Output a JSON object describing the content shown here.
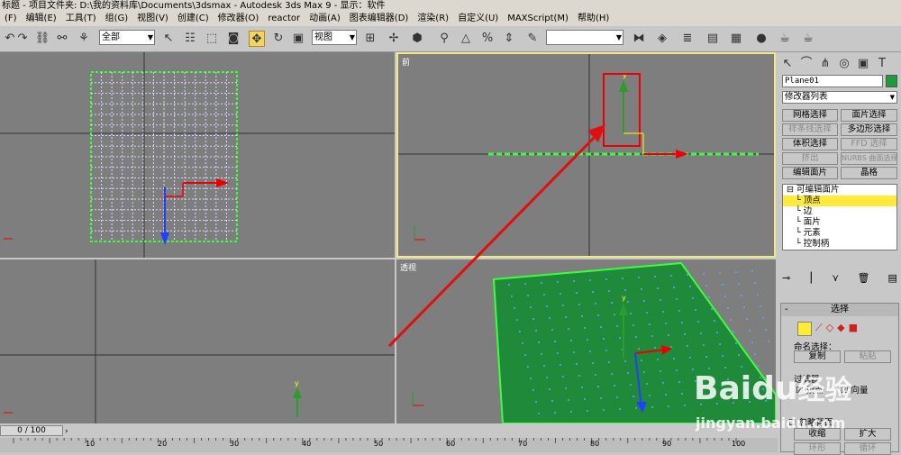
{
  "title": "标题 - 项目文件夹: D:\\我的资料库\\Documents\\3dsmax - Autodesk 3ds Max 9 - 显示：软件",
  "menu": [
    "(F)",
    "编辑(E)",
    "工具(T)",
    "组(G)",
    "视图(V)",
    "创建(C)",
    "修改器(O)",
    "reactor",
    "动画(A)",
    "图表编辑器(D)",
    "渲染(R)",
    "自定义(U)",
    "MAXScript(M)",
    "帮助(H)"
  ],
  "toolbar": {
    "selection_filter": "全部",
    "ref_coord": "视图",
    "named_sel": ""
  },
  "viewports": {
    "front_label": "前",
    "persp_label": "透视",
    "axis_x": "x",
    "axis_y": "y"
  },
  "panel": {
    "object_name": "Plane01",
    "modifier_list": "修改器列表",
    "buttons": [
      "网格选择",
      "面片选择",
      "样条线选择",
      "多边形选择",
      "体积选择",
      "FFD 选择",
      "挤出",
      "NURBS 曲面选择",
      "编辑面片",
      "晶格"
    ],
    "stack_root": "可编辑面片",
    "stack_items": [
      "顶点",
      "边",
      "面片",
      "元素",
      "控制柄"
    ],
    "rollout_title": "选择",
    "named_sel_label": "命名选择：",
    "copy_label": "复制",
    "paste_label": "粘贴",
    "filter_label": "过滤器",
    "vertex_label": "顶点",
    "vector_label": "向量",
    "ignore_back": "忽略背面",
    "shrink": "收缩",
    "grow": "扩大",
    "ring": "环形",
    "loop": "循环"
  },
  "status": {
    "frame": "0 / 100",
    "ticks": [
      "10",
      "20",
      "30",
      "40",
      "50",
      "60",
      "70",
      "80",
      "90",
      "100"
    ]
  },
  "watermark": {
    "brand": "Baidu",
    "sub": "经验",
    "url": "jingyan.baidu.com"
  }
}
